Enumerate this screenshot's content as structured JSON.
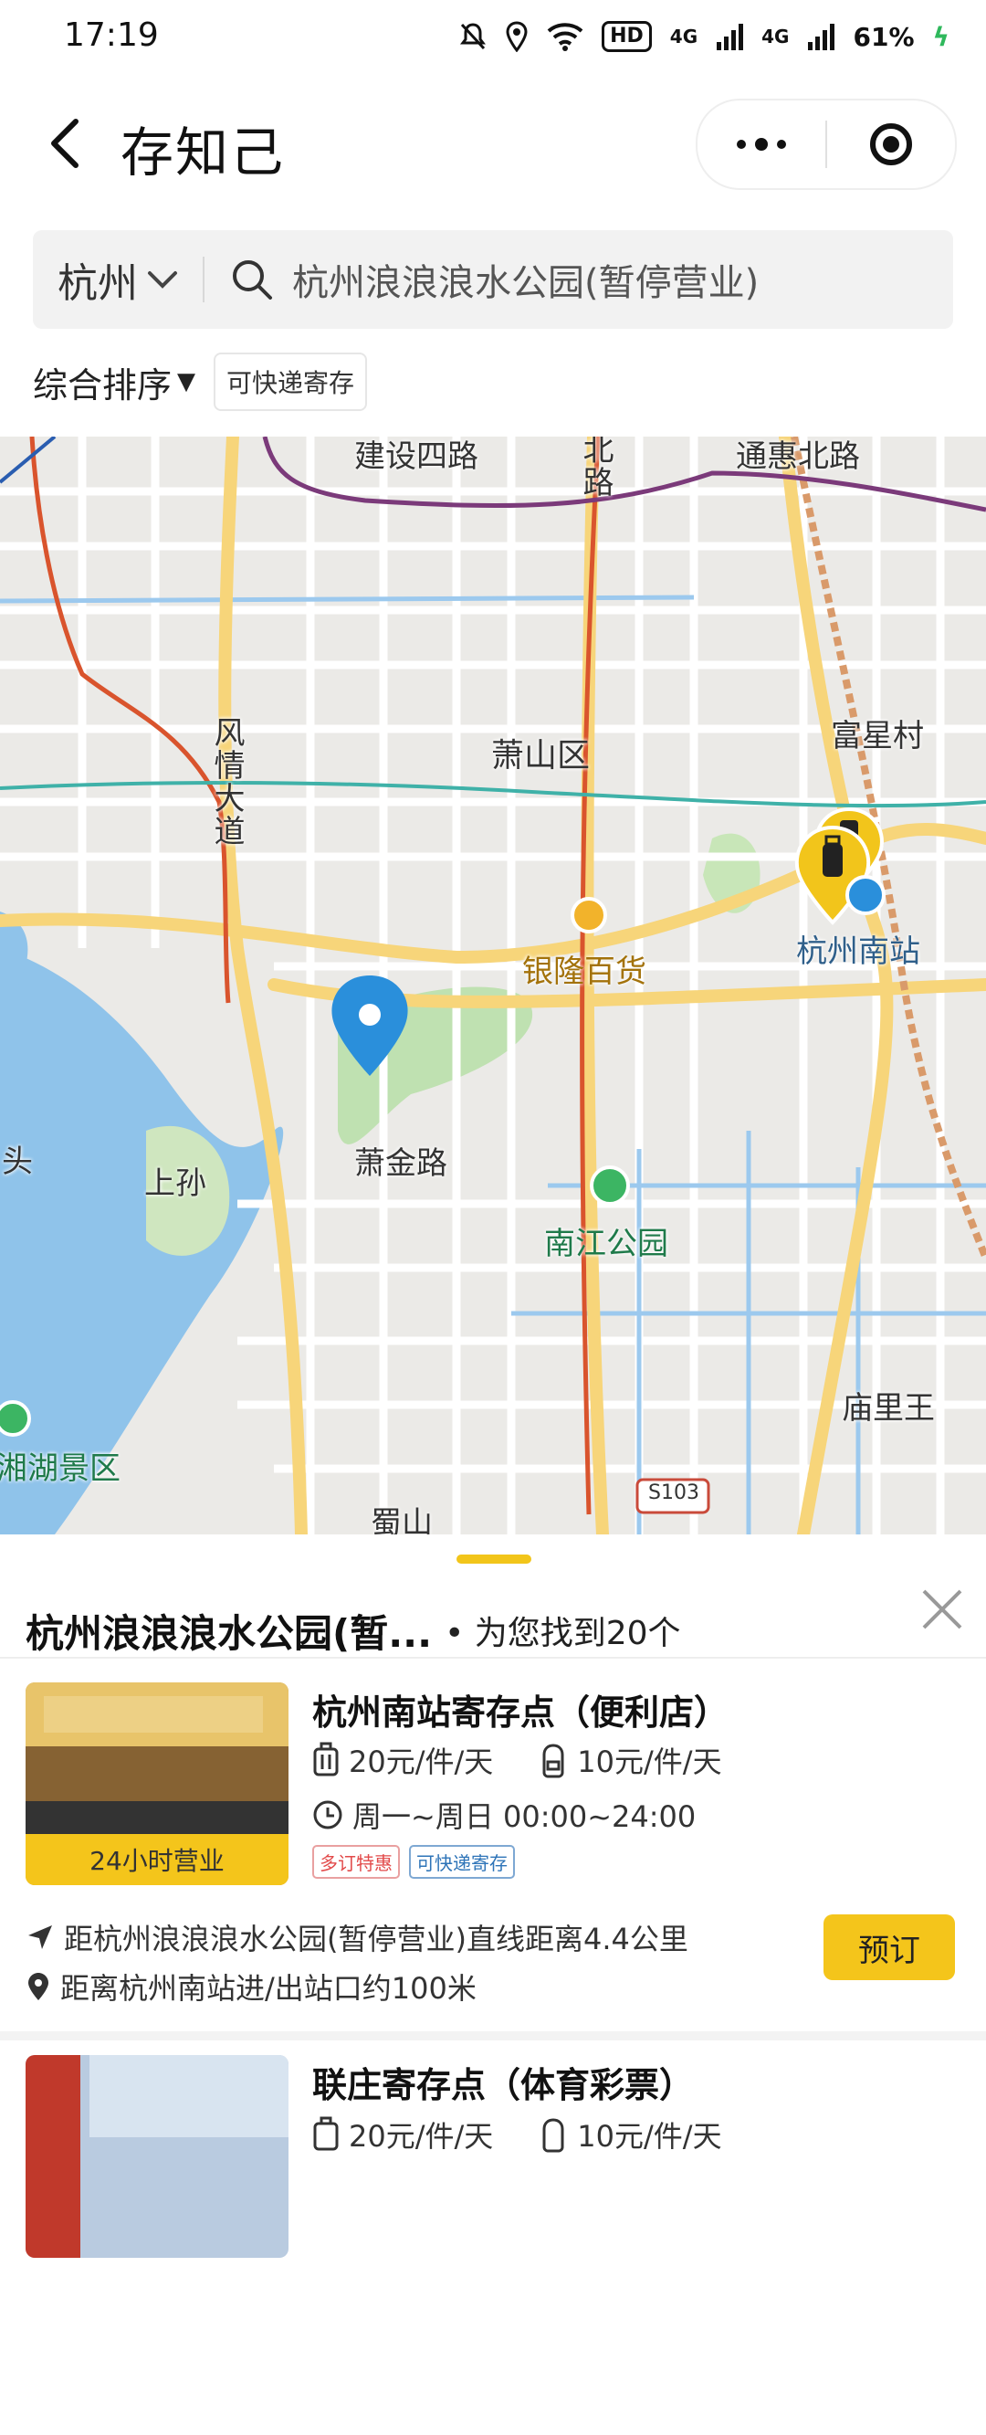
{
  "status_bar": {
    "time": "17:19",
    "hd": "HD",
    "net1": "4G",
    "net2": "4G",
    "battery": "61%"
  },
  "nav": {
    "title": "存知己"
  },
  "search": {
    "city": "杭州",
    "query": "杭州浪浪浪水公园(暂停营业)"
  },
  "filters": {
    "sort_label": "综合排序",
    "sort_arrow": "▼",
    "chip": "可快递寄存"
  },
  "map": {
    "labels": {
      "road_jianshe": "建设四路",
      "road_north": "北路",
      "road_tonghui": "通惠北路",
      "fuxing": "富星村",
      "xiaoshan": "萧山区",
      "fengqing": "风情大道",
      "yinlong": "银隆百货",
      "hz_south": "杭州南站",
      "xiaojin": "萧金路",
      "shangsun": "上孙",
      "nanjiang": "南江公园",
      "tou": "头",
      "scenic": "湘湖景区",
      "miaoli": "庙里王",
      "shu": "蜀山",
      "s103": "S103"
    }
  },
  "sheet": {
    "title": "杭州浪浪浪水公园(暂...",
    "count_text": "• 为您找到20个",
    "items": [
      {
        "name": "杭州南站寄存点（便利店）",
        "price_large": "20元/件/天",
        "price_small": "10元/件/天",
        "hours": "周一~周日 00:00~24:00",
        "badge": "24小时营业",
        "tag1": "多订特惠",
        "tag2": "可快递寄存",
        "distance": "距杭州浪浪浪水公园(暂停营业)直线距离4.4公里",
        "station": "距离杭州南站进/出站口约100米",
        "book": "预订"
      },
      {
        "name": "联庄寄存点（体育彩票）",
        "price_large": "20元/件/天",
        "price_small": "10元/件/天"
      }
    ]
  },
  "colors": {
    "accent": "#f4c51b",
    "pin_blue": "#2a8fdb"
  }
}
